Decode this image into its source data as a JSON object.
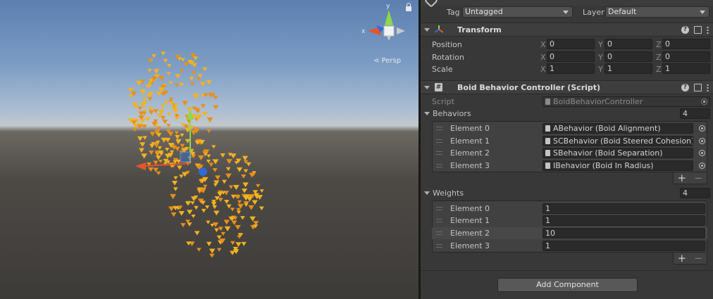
{
  "scene": {
    "persp_label": "Persp",
    "gizmo_axis_x": "x",
    "gizmo_axis_y": "y"
  },
  "inspector": {
    "tag_label": "Tag",
    "tag_value": "Untagged",
    "layer_label": "Layer",
    "layer_value": "Default",
    "transform": {
      "title": "Transform",
      "rows": [
        {
          "label": "Position",
          "x": "0",
          "y": "0",
          "z": "0"
        },
        {
          "label": "Rotation",
          "x": "0",
          "y": "0",
          "z": "0"
        },
        {
          "label": "Scale",
          "x": "1",
          "y": "1",
          "z": "1"
        }
      ],
      "axis_labels": [
        "X",
        "Y",
        "Z"
      ]
    },
    "boid": {
      "title": "Boid Behavior Controller (Script)",
      "script_label": "Script",
      "script_value": "BoidBehaviorController",
      "behaviors_label": "Behaviors",
      "behaviors_count": "4",
      "behaviors": [
        {
          "label": "Element 0",
          "value": "ABehavior (Boid Alignment)"
        },
        {
          "label": "Element 1",
          "value": "SCBehavior (Boid Steered Cohesion)"
        },
        {
          "label": "Element 2",
          "value": "SBehavior (Boid Separation)"
        },
        {
          "label": "Element 3",
          "value": "IBehavior (Boid In Radius)"
        }
      ],
      "weights_label": "Weights",
      "weights_count": "4",
      "weights": [
        {
          "label": "Element 0",
          "value": "1"
        },
        {
          "label": "Element 1",
          "value": "1"
        },
        {
          "label": "Element 2",
          "value": "10"
        },
        {
          "label": "Element 3",
          "value": "1"
        }
      ]
    },
    "add_component_label": "Add Component",
    "plus_label": "+",
    "minus_label": "−",
    "help_label": "?"
  }
}
